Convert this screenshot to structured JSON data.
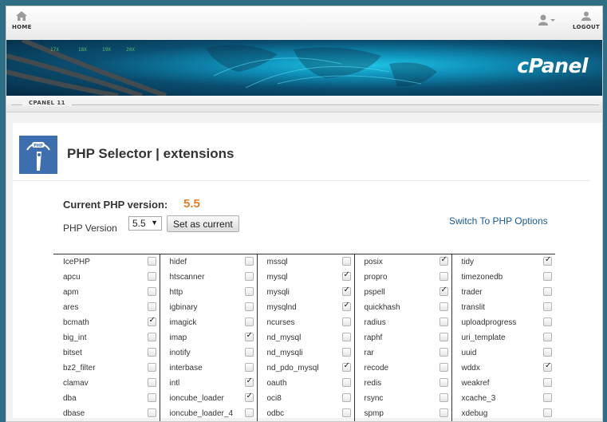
{
  "topbar": {
    "home_label": "HOME",
    "logout_label": "LOGOUT"
  },
  "banner": {
    "brand": "cPanel",
    "version_label": "CPANEL 11"
  },
  "page": {
    "title": "PHP Selector | extensions",
    "current_label": "Current PHP version:",
    "current_value": "5.5",
    "php_version_label": "PHP Version",
    "selected_version": "5.5",
    "set_button": "Set as current",
    "switch_link": "Switch To PHP Options"
  },
  "colors": {
    "accent_orange": "#e57e25",
    "link_blue": "#19588a",
    "logo_blue": "#3d6fb0"
  },
  "extensions": {
    "columns": [
      [
        {
          "name": "IcePHP",
          "checked": false
        },
        {
          "name": "apcu",
          "checked": false
        },
        {
          "name": "apm",
          "checked": false
        },
        {
          "name": "ares",
          "checked": false
        },
        {
          "name": "bcmath",
          "checked": true
        },
        {
          "name": "big_int",
          "checked": false
        },
        {
          "name": "bitset",
          "checked": false
        },
        {
          "name": "bz2_filter",
          "checked": false
        },
        {
          "name": "clamav",
          "checked": false
        },
        {
          "name": "dba",
          "checked": false
        },
        {
          "name": "dbase",
          "checked": false
        }
      ],
      [
        {
          "name": "hidef",
          "checked": false
        },
        {
          "name": "htscanner",
          "checked": false
        },
        {
          "name": "http",
          "checked": false
        },
        {
          "name": "igbinary",
          "checked": false
        },
        {
          "name": "imagick",
          "checked": false
        },
        {
          "name": "imap",
          "checked": true
        },
        {
          "name": "inotify",
          "checked": false
        },
        {
          "name": "interbase",
          "checked": false
        },
        {
          "name": "intl",
          "checked": true
        },
        {
          "name": "ioncube_loader",
          "checked": true
        },
        {
          "name": "ioncube_loader_4",
          "checked": false
        }
      ],
      [
        {
          "name": "mssql",
          "checked": false
        },
        {
          "name": "mysql",
          "checked": true
        },
        {
          "name": "mysqli",
          "checked": true
        },
        {
          "name": "mysqlnd",
          "checked": true
        },
        {
          "name": "ncurses",
          "checked": false
        },
        {
          "name": "nd_mysql",
          "checked": false
        },
        {
          "name": "nd_mysqli",
          "checked": false
        },
        {
          "name": "nd_pdo_mysql",
          "checked": true
        },
        {
          "name": "oauth",
          "checked": false
        },
        {
          "name": "oci8",
          "checked": false
        },
        {
          "name": "odbc",
          "checked": false
        }
      ],
      [
        {
          "name": "posix",
          "checked": true
        },
        {
          "name": "propro",
          "checked": false
        },
        {
          "name": "pspell",
          "checked": true
        },
        {
          "name": "quickhash",
          "checked": false
        },
        {
          "name": "radius",
          "checked": false
        },
        {
          "name": "raphf",
          "checked": false
        },
        {
          "name": "rar",
          "checked": false
        },
        {
          "name": "recode",
          "checked": false
        },
        {
          "name": "redis",
          "checked": false
        },
        {
          "name": "rsync",
          "checked": false
        },
        {
          "name": "spmp",
          "checked": false
        }
      ],
      [
        {
          "name": "tidy",
          "checked": true
        },
        {
          "name": "timezonedb",
          "checked": false
        },
        {
          "name": "trader",
          "checked": false
        },
        {
          "name": "translit",
          "checked": false
        },
        {
          "name": "uploadprogress",
          "checked": false
        },
        {
          "name": "uri_template",
          "checked": false
        },
        {
          "name": "uuid",
          "checked": false
        },
        {
          "name": "wddx",
          "checked": true
        },
        {
          "name": "weakref",
          "checked": false
        },
        {
          "name": "xcache_3",
          "checked": false
        },
        {
          "name": "xdebug",
          "checked": false
        }
      ]
    ]
  }
}
